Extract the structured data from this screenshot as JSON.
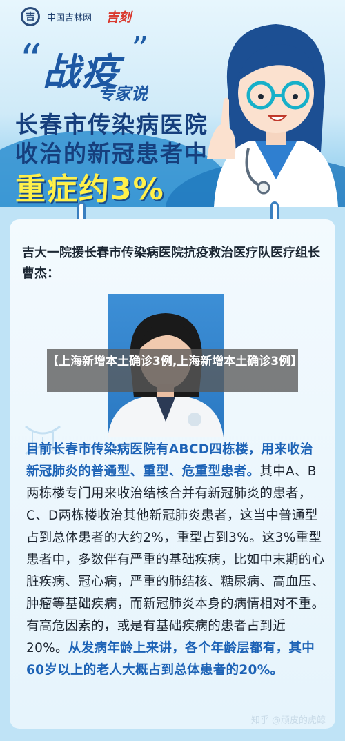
{
  "header": {
    "logo_glyph": "吉",
    "logo_text": "中国吉林网",
    "logo2_text": "吉刻",
    "title": "战疫",
    "subtitle": "专家说",
    "headline_line1": "长春市传染病医院",
    "headline_line2": "收治的新冠患者中",
    "headline_line3": "重症约3%"
  },
  "card": {
    "title": "吉大一院援长春市传染病医院抗疫救治医疗队医疗组长　曹杰：",
    "body_hl1": "目前长春市传染病医院有ABCD四栋楼，用来收治新冠肺炎的普通型、重型、危重型患者。",
    "body_normal": "其中A、B两栋楼专门用来收治结核合并有新冠肺炎的患者，C、D两栋楼收治其他新冠肺炎患者，这当中普通型占到总体患者的大约2%，重型占到3%。这3%重型患者中，多数伴有严重的基础疾病，比如中末期的心脏疾病、冠心病，严重的肺结核、糖尿病、高血压、肿瘤等基础疾病，而新冠肺炎本身的病情相对不重。有高危因素的，或是有基础疾病的患者占到近20%。",
    "body_hl2": "从发病年龄上来讲，各个年龄层都有，其中60岁以上的老人大概占到总体患者的20%。"
  },
  "banner": {
    "text": "【上海新增本土确诊3例,上海新增本土确诊3例】"
  },
  "watermark": "知乎 @顽皮的虎鲸",
  "colors": {
    "primary_blue": "#1d58a3",
    "highlight_yellow": "#fff04a",
    "text_dark": "#1d2530",
    "highlight_text_blue": "#1d63b6"
  }
}
